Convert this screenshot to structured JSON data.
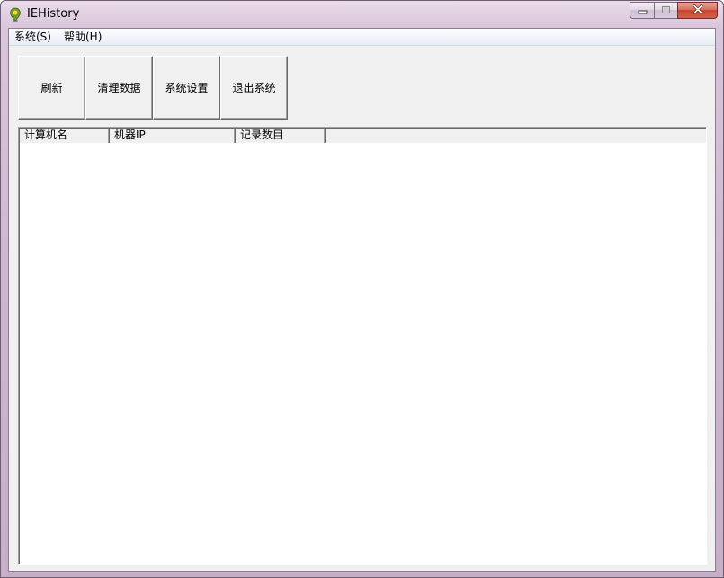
{
  "window": {
    "title": "IEHistory"
  },
  "menu": {
    "items": [
      {
        "label": "系统(S)"
      },
      {
        "label": "帮助(H)"
      }
    ]
  },
  "toolbar": {
    "buttons": [
      {
        "label": "刷新"
      },
      {
        "label": "清理数据"
      },
      {
        "label": "系统设置"
      },
      {
        "label": "退出系统"
      }
    ]
  },
  "list": {
    "columns": [
      {
        "label": "计算机名"
      },
      {
        "label": "机器IP"
      },
      {
        "label": "记录数目"
      }
    ],
    "rows": []
  },
  "icons": {
    "app": "ie-history-pin-icon",
    "minimize": "minimize-icon",
    "maximize": "maximize-icon",
    "close": "close-icon"
  },
  "colors": {
    "title_frame": "#d9c6da",
    "close_button": "#c4442e",
    "client_bg": "#f0f0f0"
  }
}
